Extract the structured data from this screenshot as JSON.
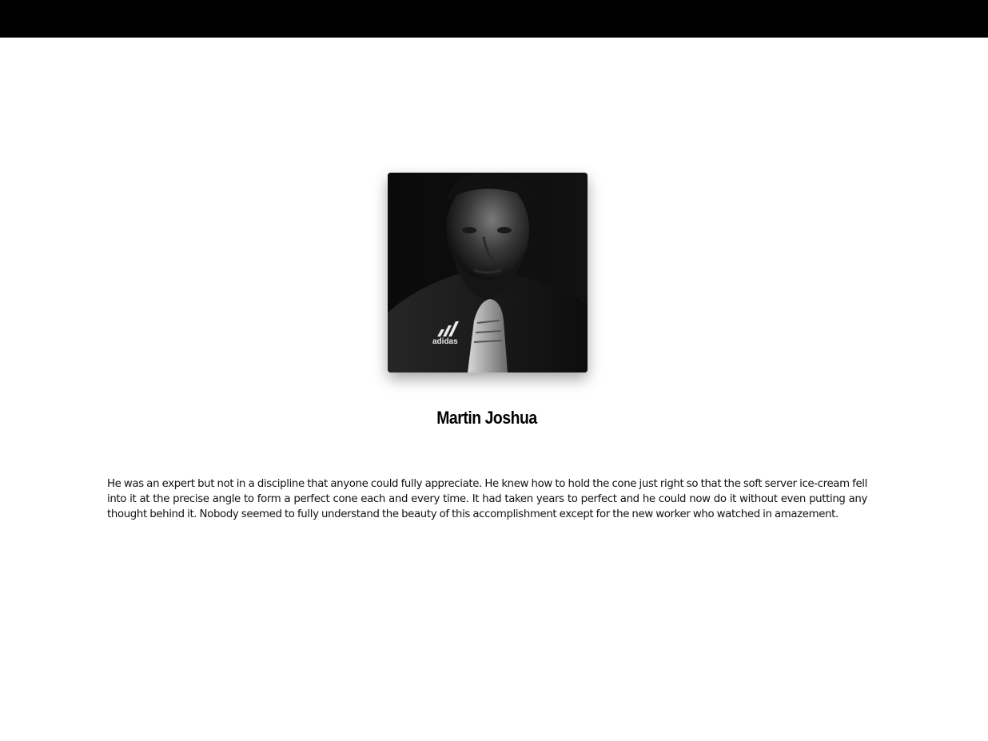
{
  "profile": {
    "name": "Martin Joshua",
    "photo_icon": "person-portrait",
    "shirt_logo_text": "adidas",
    "bio": "He was an expert but not in a discipline that anyone could fully appreciate. He knew how to hold the cone just right so that the soft server ice-cream fell into it at the precise angle to form a perfect cone each and every time. It had taken years to perfect and he could now do it without even putting any thought behind it. Nobody seemed to fully understand the beauty of this accomplishment except for the new worker who watched in amazement."
  },
  "colors": {
    "topbar": "#000000",
    "background": "#ffffff",
    "text": "#111111"
  }
}
